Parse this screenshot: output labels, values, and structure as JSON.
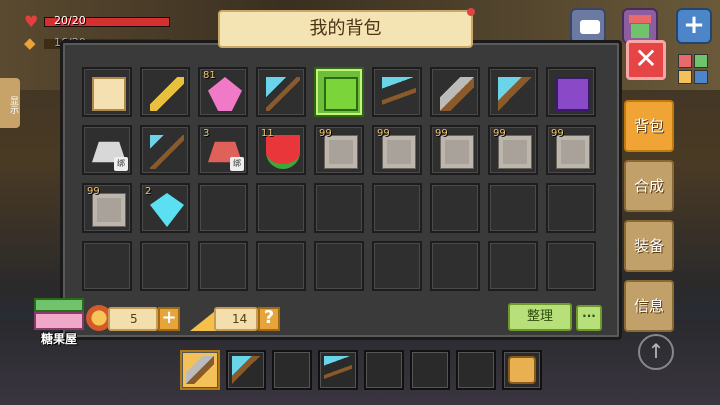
{
  "hud": {
    "health_text": "20/20",
    "health_fraction": 1.0,
    "hunger_text": "16/20",
    "side_hint": "显示"
  },
  "title": "我的背包",
  "close_symbol": "✕",
  "side_tabs": [
    {
      "label": "背包",
      "active": true
    },
    {
      "label": "合成",
      "active": false
    },
    {
      "label": "装备",
      "active": false
    },
    {
      "label": "信息",
      "active": false
    }
  ],
  "slots": [
    {
      "icon": "map-scroll-icon",
      "count": "",
      "bound": false
    },
    {
      "icon": "golden-shovel-icon",
      "count": "",
      "bound": false
    },
    {
      "icon": "pink-crystal-icon",
      "count": "81",
      "bound": false
    },
    {
      "icon": "diamond-shovel-icon",
      "count": "",
      "bound": false
    },
    {
      "icon": "green-key-card-icon",
      "count": "",
      "bound": false,
      "selected": true
    },
    {
      "icon": "diamond-pickaxe-icon",
      "count": "",
      "bound": false
    },
    {
      "icon": "stone-sword-icon",
      "count": "",
      "bound": false
    },
    {
      "icon": "diamond-axe-icon",
      "count": "",
      "bound": false
    },
    {
      "icon": "purple-book-icon",
      "count": "",
      "bound": false
    },
    {
      "icon": "iron-ingot-icon",
      "count": "",
      "bound": true
    },
    {
      "icon": "diamond-hoe-icon",
      "count": "",
      "bound": false
    },
    {
      "icon": "copper-ingot-icon",
      "count": "3",
      "bound": true
    },
    {
      "icon": "watermelon-slice-icon",
      "count": "11",
      "bound": false
    },
    {
      "icon": "stone-block-icon",
      "count": "99",
      "bound": false
    },
    {
      "icon": "stone-block-icon",
      "count": "99",
      "bound": false
    },
    {
      "icon": "stone-block-icon",
      "count": "99",
      "bound": false
    },
    {
      "icon": "stone-block-icon",
      "count": "99",
      "bound": false
    },
    {
      "icon": "stone-block-icon",
      "count": "99",
      "bound": false
    },
    {
      "icon": "stone-block-icon",
      "count": "99",
      "bound": false
    },
    {
      "icon": "diamond-gem-icon",
      "count": "2",
      "bound": false
    }
  ],
  "bind_label": "绑",
  "resources": {
    "coins": "5",
    "cheese": "14"
  },
  "sort_label": "整理",
  "more_label": "···",
  "candy_house_label": "糖果屋",
  "hotbar": [
    {
      "icon": "stone-sword-icon",
      "selected": true
    },
    {
      "icon": "diamond-axe-icon",
      "selected": false
    },
    {
      "icon": "",
      "selected": false
    },
    {
      "icon": "diamond-pickaxe-icon",
      "selected": false
    },
    {
      "icon": "",
      "selected": false
    },
    {
      "icon": "",
      "selected": false
    },
    {
      "icon": "",
      "selected": false
    },
    {
      "icon": "backpack-icon",
      "selected": false
    }
  ],
  "colors": {
    "selected_slot": "#6bbf3b",
    "active_tab": "#f0a436",
    "close": "#e64545"
  }
}
